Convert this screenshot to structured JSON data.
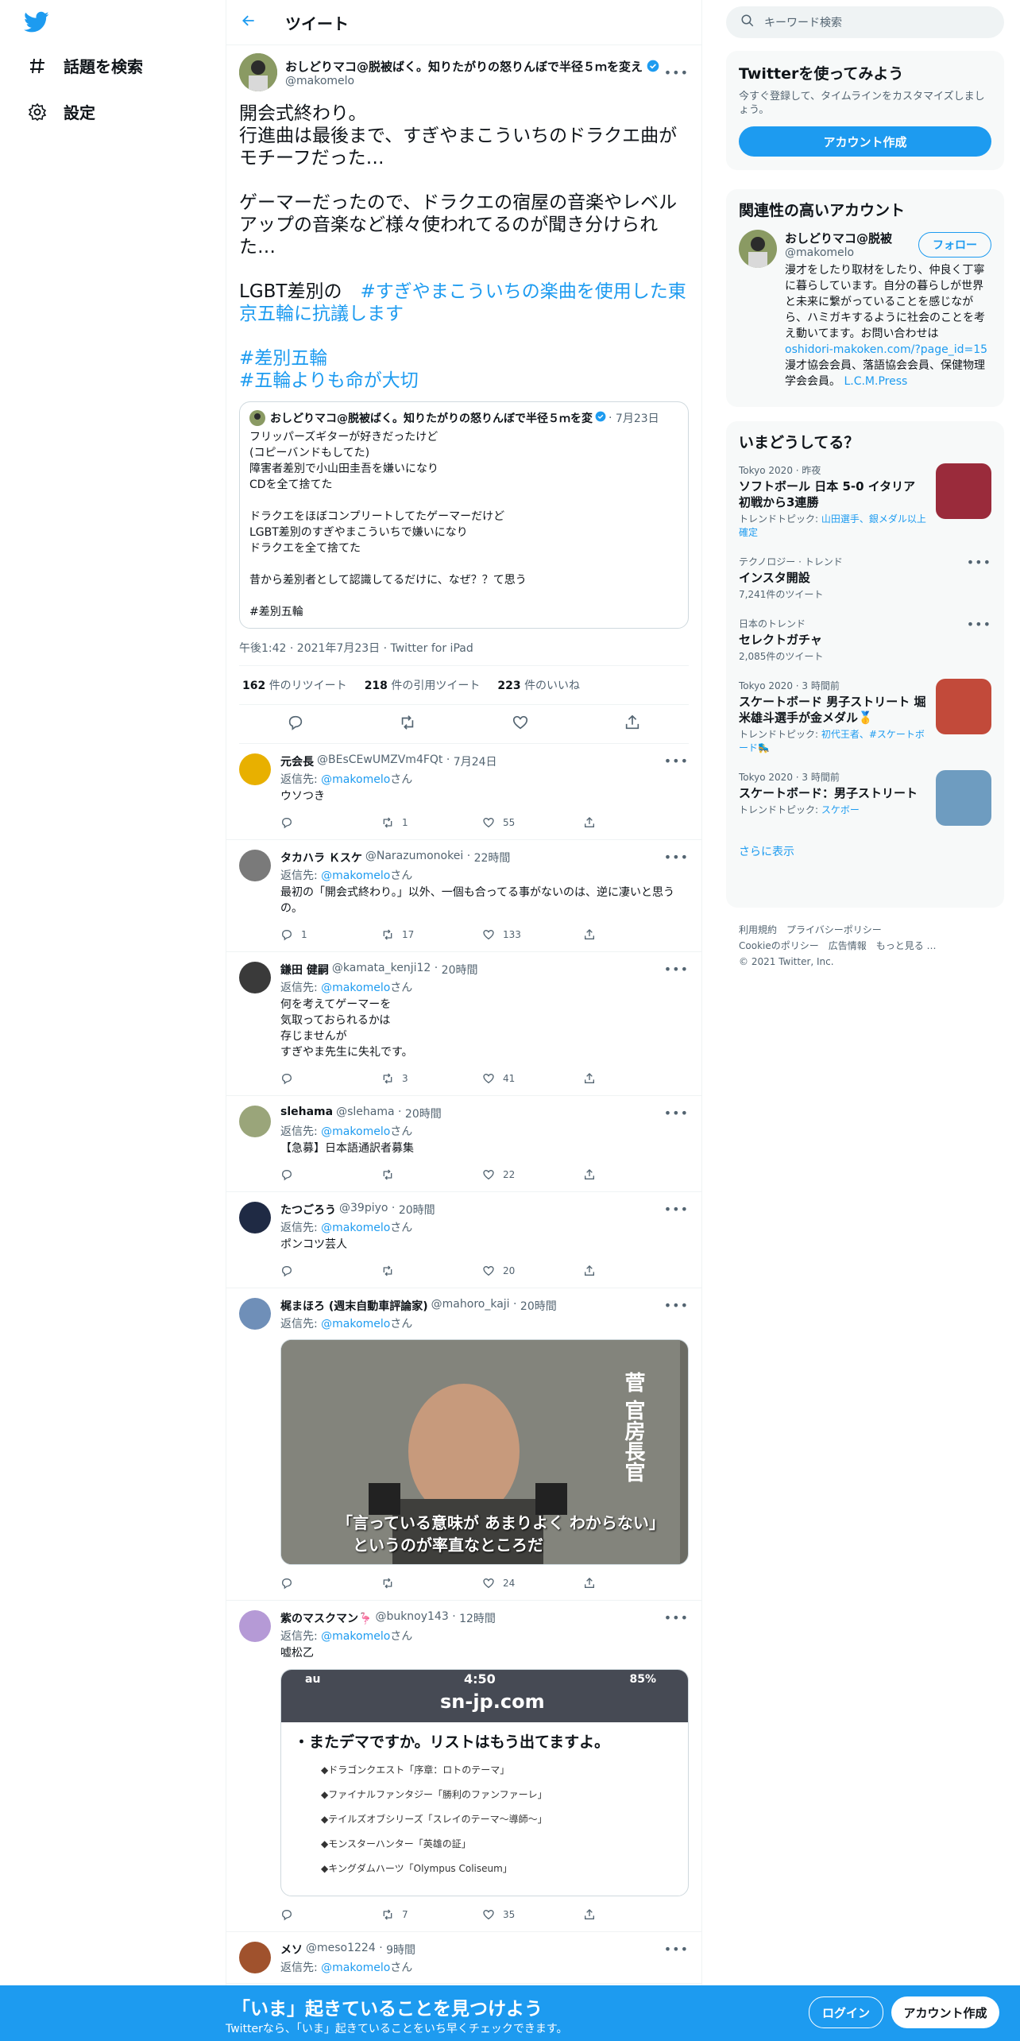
{
  "nav": {
    "explore_label": "話題を検索",
    "settings_label": "設定"
  },
  "header": {
    "title": "ツイート"
  },
  "main_tweet": {
    "display_name": "おしどりマコ@脱被ばく。知りたがりの怒りんぼで半径５ｍを変え",
    "handle": "@makomelo",
    "text_plain1": "開会式終わり。\n行進曲は最後まで、すぎやまこういちのドラクエ曲がモチーフだった…\n\nゲーマーだったので、ドラクエの宿屋の音楽やレベルアップの音楽など様々使われてるのが聞き分けられた…\n\nLGBT差別の　",
    "hashtag1": "#すぎやまこういちの楽曲を使用した東京五輪に抗議します",
    "hashtag2": "#差別五輪",
    "hashtag3": "#五輪よりも命が大切",
    "quote": {
      "display_name": "おしどりマコ@脱被ばく。知りたがりの怒りんぼで半径５ｍを変",
      "date": "7月23日",
      "text": "フリッパーズギターが好きだったけど\n(コピーバンドもしてた)\n障害者差別で小山田圭吾を嫌いになり\nCDを全て捨てた\n\nドラクエをほぼコンプリートしてたゲーマーだけど\nLGBT差別のすぎやまこういちで嫌いになり\nドラクエを全て捨てた\n\n昔から差別者として認識してるだけに、なぜ？？て思う\n\n#差別五輪"
    },
    "meta": "午後1:42 · 2021年7月23日 · Twitter for iPad",
    "retweets": "162",
    "retweets_label": "件のリツイート",
    "quotes": "218",
    "quotes_label": "件の引用ツイート",
    "likes": "223",
    "likes_label": "件のいいね"
  },
  "replies": [
    {
      "name": "元会長",
      "handle": "@BEsCEwUMZVm4FQt",
      "time": "7月24日",
      "replyto_prefix": "返信先: ",
      "replyto": "@makomelo",
      "replyto_suffix": "さん",
      "text": "ウソつき",
      "replies": "",
      "retweets": "1",
      "likes": "55"
    },
    {
      "name": "タカハラ Ｋスケ",
      "handle": "@Narazumonokei",
      "time": "22時間",
      "replyto_prefix": "返信先: ",
      "replyto": "@makomelo",
      "replyto_suffix": "さん",
      "text": "最初の「開会式終わり。」以外、一個も合ってる事がないのは、逆に凄いと思うの。",
      "replies": "1",
      "retweets": "17",
      "likes": "133"
    },
    {
      "name": "鎌田 健嗣",
      "handle": "@kamata_kenji12",
      "time": "20時間",
      "replyto_prefix": "返信先: ",
      "replyto": "@makomelo",
      "replyto_suffix": "さん",
      "text": "何を考えてゲーマーを\n気取っておられるかは\n存じませんが\nすぎやま先生に失礼です。",
      "replies": "",
      "retweets": "3",
      "likes": "41"
    },
    {
      "name": "slehama",
      "handle": "@slehama",
      "time": "20時間",
      "replyto_prefix": "返信先: ",
      "replyto": "@makomelo",
      "replyto_suffix": "さん",
      "text": "【急募】日本語通訳者募集",
      "replies": "",
      "retweets": "",
      "likes": "22"
    },
    {
      "name": "たつごろう",
      "handle": "@39piyo",
      "time": "20時間",
      "replyto_prefix": "返信先: ",
      "replyto": "@makomelo",
      "replyto_suffix": "さん",
      "text": "ポンコツ芸人",
      "replies": "",
      "retweets": "",
      "likes": "20"
    },
    {
      "name": "梶まほろ (週末自動車評論家)",
      "handle": "@mahoro_kaji",
      "time": "20時間",
      "replyto_prefix": "返信先: ",
      "replyto": "@makomelo",
      "replyto_suffix": "さん",
      "text": "",
      "replies": "",
      "retweets": "",
      "likes": "24",
      "media_caption1": "「言っている意味が あまりよく わからない」",
      "media_caption2": "というのが率直なところだ",
      "media_side": "菅 官房長官"
    },
    {
      "name": "紫のマスクマン🦩",
      "handle": "@buknoy143",
      "time": "12時間",
      "replyto_prefix": "返信先: ",
      "replyto": "@makomelo",
      "replyto_suffix": "さん",
      "text": "嘘松乙",
      "replies": "",
      "retweets": "7",
      "likes": "35",
      "phone": {
        "carrier": "au",
        "clock": "4:50",
        "battery": "85%",
        "site": "sn-jp.com",
        "headline": "・またデマですか。リストはもう出てますよ。",
        "items": [
          "◆ドラゴンクエスト「序章：ロトのテーマ」",
          "◆ファイナルファンタジー「勝利のファンファーレ」",
          "◆テイルズオブシリーズ「スレイのテーマ～導師～」",
          "◆モンスターハンター「英雄の証」",
          "◆キングダムハーツ「Olympus Coliseum」"
        ]
      }
    },
    {
      "name": "メソ",
      "handle": "@meso1224",
      "time": "9時間",
      "replyto_prefix": "返信先: ",
      "replyto": "@makomelo",
      "replyto_suffix": "さん",
      "text": ""
    }
  ],
  "search": {
    "placeholder": "キーワード検索"
  },
  "signup_card": {
    "title": "Twitterを使ってみよう",
    "desc": "今すぐ登録して、タイムラインをカスタマイズしましょう。",
    "button": "アカウント作成"
  },
  "relevant": {
    "title": "関連性の高いアカウント",
    "name": "おしどりマコ@脱被",
    "handle": "@makomelo",
    "follow": "フォロー",
    "bio1": "漫才をしたり取材をしたり、仲良く丁寧に暮らしています。自分の暮らしが世界と未来に繋がっていることを感じながら、ハミガキするように社会のことを考え動いてます。お問い合わせは",
    "bio_link": "oshidori-makoken.com/?page_id=15",
    "bio2": "漫才協会会員、落語協会会員、保健物理学会会員。",
    "bio_link2": "L.C.M.Press"
  },
  "trends": {
    "title": "いまどうしてる？",
    "items": [
      {
        "context": "Tokyo 2020 · 昨夜",
        "name": "ソフトボール 日本 5-0 イタリア 初戦から3連勝",
        "extra_prefix": "トレンドトピック: ",
        "extra": "山田選手、銀メダル以上確定",
        "count": ""
      },
      {
        "context": "テクノロジー · トレンド",
        "name": "インスタ開設",
        "extra_prefix": "",
        "extra": "",
        "count": "7,241件のツイート"
      },
      {
        "context": "日本のトレンド",
        "name": "セレクトガチャ",
        "extra_prefix": "",
        "extra": "",
        "count": "2,085件のツイート"
      },
      {
        "context": "Tokyo 2020 · 3 時間前",
        "name": "スケートボード 男子ストリート 堀米雄斗選手が金メダル🥇",
        "extra_prefix": "トレンドトピック: ",
        "extra": "初代王者、#スケートボード🛼",
        "count": ""
      },
      {
        "context": "Tokyo 2020 · 3 時間前",
        "name": "スケートボード：男子ストリート",
        "extra_prefix": "トレンドトピック: ",
        "extra": "スケボー",
        "count": ""
      }
    ],
    "more": "さらに表示"
  },
  "footer": {
    "line1": "利用規約　プライバシーポリシー",
    "line2": "Cookieのポリシー　広告情報　もっと見る …",
    "line3": "© 2021 Twitter, Inc."
  },
  "bottombar": {
    "headline": "「いま」起きていることを見つけよう",
    "sub": "Twitterなら、「いま」起きていることをいち早くチェックできます。",
    "login": "ログイン",
    "signup": "アカウント作成"
  },
  "colors": {
    "accent": "#1d9bf0",
    "text": "#0f1419",
    "muted": "#536471"
  }
}
